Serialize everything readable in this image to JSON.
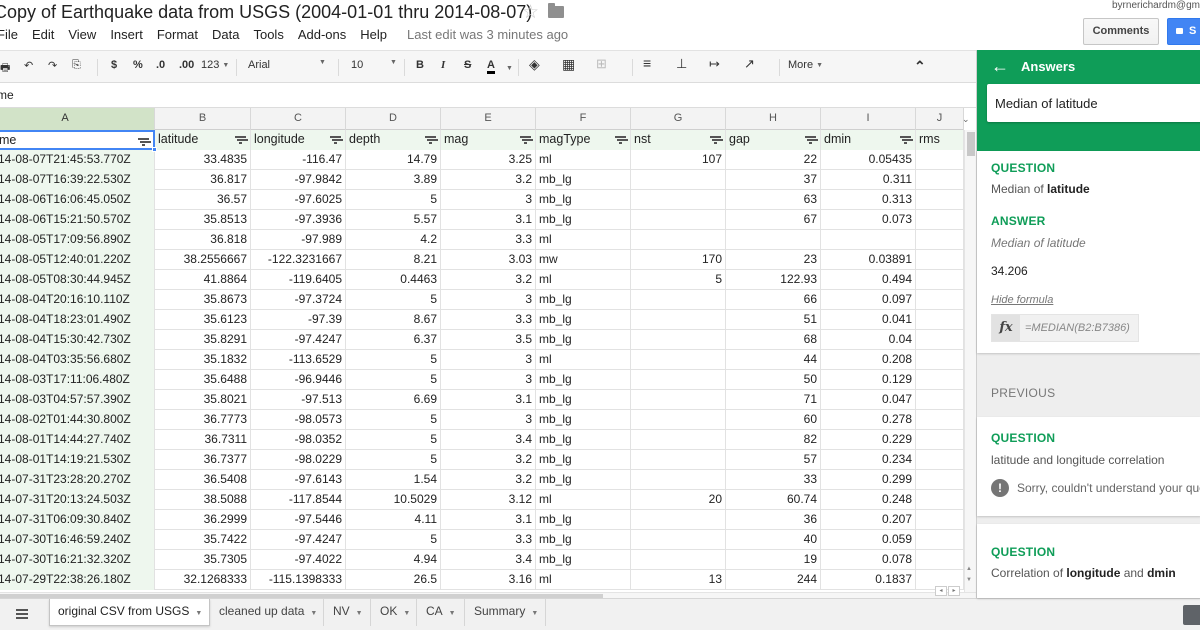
{
  "title": {
    "doc_title": "Copy of Earthquake data from USGS (2004-01-01 thru 2014-08-07)",
    "star_glyph": "☆",
    "user_email": "byrnerichardm@gm",
    "comments_label": "Comments",
    "share_label": "S"
  },
  "menu": {
    "items": [
      "File",
      "Edit",
      "View",
      "Insert",
      "Format",
      "Data",
      "Tools",
      "Add-ons",
      "Help"
    ],
    "last_edit": "Last edit was 3 minutes ago"
  },
  "toolbar": {
    "currency": "$",
    "percent": "%",
    "dec_decrease": ".0",
    "dec_increase": ".00",
    "number_format": "123",
    "font": "Arial",
    "font_size": "10",
    "bold": "B",
    "italic": "I",
    "strike": "S",
    "text_color": "A",
    "more": "More",
    "collapse": "⌃"
  },
  "formula_bar": {
    "content": "me"
  },
  "grid": {
    "columns": [
      "A",
      "B",
      "C",
      "D",
      "E",
      "F",
      "G",
      "H",
      "I",
      "J"
    ],
    "selected_column": "A",
    "header_row": [
      "me",
      "latitude",
      "longitude",
      "depth",
      "mag",
      "magType",
      "nst",
      "gap",
      "dmin",
      "rms"
    ],
    "rows": [
      [
        "14-08-07T21:45:53.770Z",
        "33.4835",
        "-116.47",
        "14.79",
        "3.25",
        "ml",
        "107",
        "22",
        "0.05435",
        ""
      ],
      [
        "14-08-07T16:39:22.530Z",
        "36.817",
        "-97.9842",
        "3.89",
        "3.2",
        "mb_lg",
        "",
        "37",
        "0.311",
        ""
      ],
      [
        "14-08-06T16:06:45.050Z",
        "36.57",
        "-97.6025",
        "5",
        "3",
        "mb_lg",
        "",
        "63",
        "0.313",
        ""
      ],
      [
        "14-08-06T15:21:50.570Z",
        "35.8513",
        "-97.3936",
        "5.57",
        "3.1",
        "mb_lg",
        "",
        "67",
        "0.073",
        ""
      ],
      [
        "14-08-05T17:09:56.890Z",
        "36.818",
        "-97.989",
        "4.2",
        "3.3",
        "ml",
        "",
        "",
        "",
        ""
      ],
      [
        "14-08-05T12:40:01.220Z",
        "38.2556667",
        "-122.3231667",
        "8.21",
        "3.03",
        "mw",
        "170",
        "23",
        "0.03891",
        ""
      ],
      [
        "14-08-05T08:30:44.945Z",
        "41.8864",
        "-119.6405",
        "0.4463",
        "3.2",
        "ml",
        "5",
        "122.93",
        "0.494",
        ""
      ],
      [
        "14-08-04T20:16:10.110Z",
        "35.8673",
        "-97.3724",
        "5",
        "3",
        "mb_lg",
        "",
        "66",
        "0.097",
        ""
      ],
      [
        "14-08-04T18:23:01.490Z",
        "35.6123",
        "-97.39",
        "8.67",
        "3.3",
        "mb_lg",
        "",
        "51",
        "0.041",
        ""
      ],
      [
        "14-08-04T15:30:42.730Z",
        "35.8291",
        "-97.4247",
        "6.37",
        "3.5",
        "mb_lg",
        "",
        "68",
        "0.04",
        ""
      ],
      [
        "14-08-04T03:35:56.680Z",
        "35.1832",
        "-113.6529",
        "5",
        "3",
        "ml",
        "",
        "44",
        "0.208",
        ""
      ],
      [
        "14-08-03T17:11:06.480Z",
        "35.6488",
        "-96.9446",
        "5",
        "3",
        "mb_lg",
        "",
        "50",
        "0.129",
        ""
      ],
      [
        "14-08-03T04:57:57.390Z",
        "35.8021",
        "-97.513",
        "6.69",
        "3.1",
        "mb_lg",
        "",
        "71",
        "0.047",
        ""
      ],
      [
        "14-08-02T01:44:30.800Z",
        "36.7773",
        "-98.0573",
        "5",
        "3",
        "mb_lg",
        "",
        "60",
        "0.278",
        ""
      ],
      [
        "14-08-01T14:44:27.740Z",
        "36.7311",
        "-98.0352",
        "5",
        "3.4",
        "mb_lg",
        "",
        "82",
        "0.229",
        ""
      ],
      [
        "14-08-01T14:19:21.530Z",
        "36.7377",
        "-98.0229",
        "5",
        "3.2",
        "mb_lg",
        "",
        "57",
        "0.234",
        ""
      ],
      [
        "14-07-31T23:28:20.270Z",
        "36.5408",
        "-97.6143",
        "1.54",
        "3.2",
        "mb_lg",
        "",
        "33",
        "0.299",
        ""
      ],
      [
        "14-07-31T20:13:24.503Z",
        "38.5088",
        "-117.8544",
        "10.5029",
        "3.12",
        "ml",
        "20",
        "60.74",
        "0.248",
        ""
      ],
      [
        "14-07-31T06:09:30.840Z",
        "36.2999",
        "-97.5446",
        "4.11",
        "3.1",
        "mb_lg",
        "",
        "36",
        "0.207",
        ""
      ],
      [
        "14-07-30T16:46:59.240Z",
        "35.7422",
        "-97.4247",
        "5",
        "3.3",
        "mb_lg",
        "",
        "40",
        "0.059",
        ""
      ],
      [
        "14-07-30T16:21:32.320Z",
        "35.7305",
        "-97.4022",
        "4.94",
        "3.4",
        "mb_lg",
        "",
        "19",
        "0.078",
        ""
      ],
      [
        "14-07-29T22:38:26.180Z",
        "32.1268333",
        "-115.1398333",
        "26.5",
        "3.16",
        "ml",
        "13",
        "244",
        "0.1837",
        ""
      ]
    ]
  },
  "sheet_tabs": [
    {
      "label": "original CSV from USGS",
      "active": true
    },
    {
      "label": "cleaned up data",
      "active": false
    },
    {
      "label": "NV",
      "active": false
    },
    {
      "label": "OK",
      "active": false
    },
    {
      "label": "CA",
      "active": false
    },
    {
      "label": "Summary",
      "active": false
    }
  ],
  "answers": {
    "title": "Answers",
    "search_value": "Median of latitude",
    "current": {
      "question_label": "QUESTION",
      "question_prefix": "Median of ",
      "question_bold": "latitude",
      "answer_label": "ANSWER",
      "answer_desc": "Median of latitude",
      "answer_value": "34.206",
      "hide_formula": "Hide formula",
      "formula": "=MEDIAN(B2:B7386)"
    },
    "previous_label": "PREVIOUS",
    "prev1": {
      "question_label": "QUESTION",
      "question_text": "latitude and longitude correlation",
      "error_text": "Sorry, couldn't understand your que"
    },
    "prev2": {
      "question_label": "QUESTION",
      "question_prefix": "Correlation of ",
      "question_bold1": "longitude",
      "question_mid": " and ",
      "question_bold2": "dmin"
    }
  },
  "colors": {
    "accent_green": "#0f9d58",
    "selection_blue": "#4285f4",
    "header_row_fill": "#eef7ee"
  }
}
